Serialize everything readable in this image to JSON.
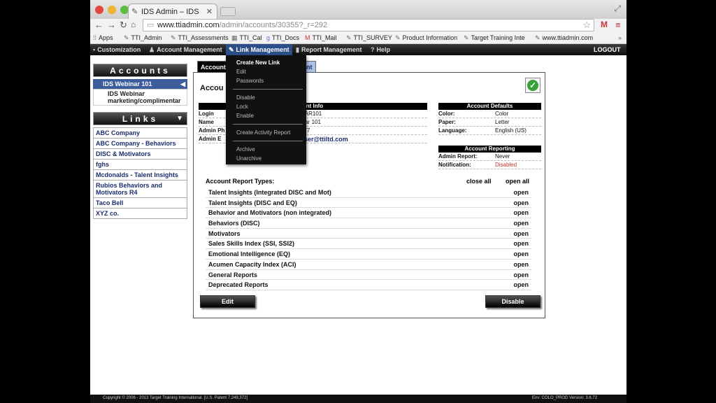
{
  "browser": {
    "tab_title": "IDS Admin – IDS",
    "url_host": "www.ttiadmin.com",
    "url_path": "/admin/accounts/30355?_r=292"
  },
  "bookmarks": [
    "Apps",
    "TTI_Admin",
    "TTI_Assessments",
    "TTI_Cal",
    "TTI_Docs",
    "TTI_Mail",
    "TTI_SURVEY",
    "Product Information",
    "Target Training Inte",
    "www.ttiadmin.com"
  ],
  "nav": {
    "customization": "Customization",
    "account_mgmt": "Account Management",
    "link_mgmt": "Link Management",
    "report_mgmt": "Report Management",
    "help": "Help",
    "logout": "LOGOUT"
  },
  "dropdown": {
    "create_new_link": "Create New Link",
    "edit": "Edit",
    "passwords": "Passwords",
    "disable": "Disable",
    "lock": "Lock",
    "enable": "Enable",
    "create_activity_report": "Create Activity Report",
    "archive": "Archive",
    "unarchive": "Unarchive"
  },
  "accounts_panel": {
    "title": "Accounts",
    "selected": "IDS Webinar 101",
    "sub": "IDS Webinar marketing/complimentar"
  },
  "links_panel": {
    "title": "Links",
    "items": [
      "ABC Company",
      "ABC Company - Behaviors",
      "DISC & Motivators",
      "fghs",
      "Mcdonalds - Talent Insights",
      "Rubios Behaviors and Motivators R4",
      "Taco Bell",
      "XYZ co."
    ]
  },
  "tabs": {
    "t1": "Account",
    "t2": "ount Info"
  },
  "card": {
    "title": "Accou",
    "info_head": "unt Info",
    "login_label": "Login",
    "login_val": "NAR101",
    "name_label": "Name",
    "name_val": "inar 101",
    "ph_label": "Admin Ph",
    "ph_val": "077",
    "em_label": "Admin E",
    "em_val": "sser@ttiltd.com",
    "defaults_head": "Account Defaults",
    "color_label": "Color:",
    "color_val": "Color",
    "paper_label": "Paper:",
    "paper_val": "Letter",
    "lang_label": "Language:",
    "lang_val": "English (US)",
    "reporting_head": "Account Reporting",
    "ar_label": "Admin Report:",
    "ar_val": "Never",
    "notif_label": "Notification:",
    "notif_val": "Disabled",
    "types_label": "Account Report Types:",
    "close_all": "close all",
    "open_all": "open all",
    "open_word": "open",
    "report_types": [
      "Talent Insights (Integrated DISC and Mot)",
      "Talent Insights (DISC and EQ)",
      "Behavior and Motivators (non integrated)",
      "Behaviors (DISC)",
      "Motivators",
      "Sales Skills Index (SSI, SSI2)",
      "Emotional Intelligence (EQ)",
      "Acumen Capacity Index (ACI)",
      "General Reports",
      "Deprecated Reports"
    ],
    "edit_btn": "Edit",
    "disable_btn": "Disable"
  },
  "footer": {
    "copyright": "Copyright © 2006 - 2013 Target Training International.   [U.S. Patent 7,249,372]",
    "env": "Env: COLO_PROD   Version: 3.6.72"
  }
}
